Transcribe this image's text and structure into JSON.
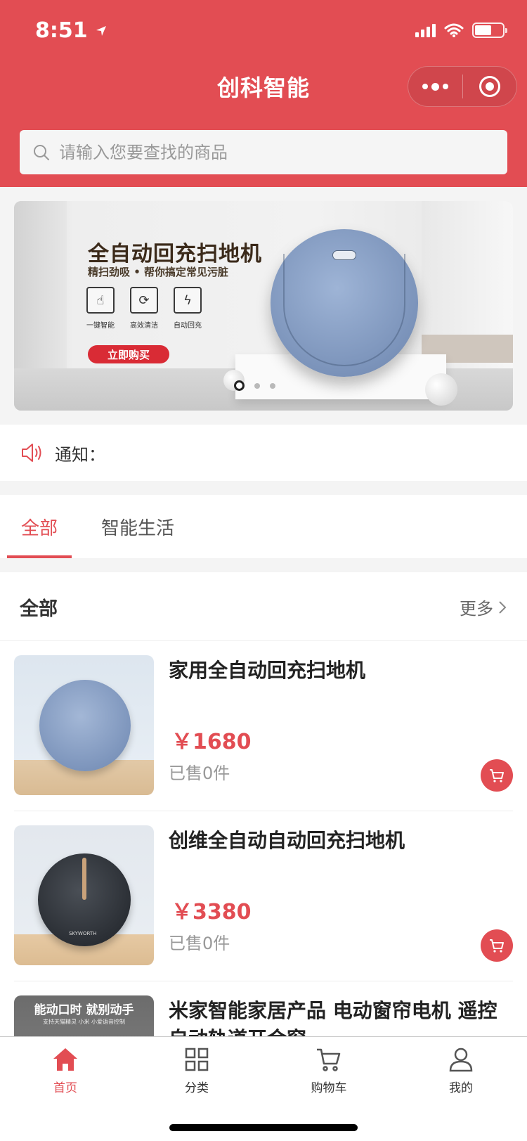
{
  "status_bar": {
    "time": "8:51"
  },
  "nav": {
    "title": "创科智能"
  },
  "search": {
    "placeholder": "请输入您要查找的商品"
  },
  "banner": {
    "title": "全自动回充扫地机",
    "subtitle": "精扫劲吸 • 帮你搞定常见污脏",
    "features": [
      {
        "label": "一键智能",
        "icon": "tap-icon"
      },
      {
        "label": "高效清洁",
        "icon": "swirl-icon"
      },
      {
        "label": "自动回充",
        "icon": "lightning-icon"
      }
    ],
    "buy_label": "立即购买",
    "slide_index": 1,
    "slide_count": 3
  },
  "notice": {
    "label": "通知："
  },
  "tabs": [
    {
      "label": "全部",
      "active": true
    },
    {
      "label": "智能生活",
      "active": false
    }
  ],
  "section": {
    "title": "全部",
    "more_label": "更多",
    "products": [
      {
        "name": "家用全自动回充扫地机",
        "price": "￥1680",
        "sold": "已售0件"
      },
      {
        "name": "创维全自动自动回充扫地机",
        "price": "￥3380",
        "sold": "已售0件",
        "thumb_brand": "SKYWORTH"
      },
      {
        "name": "米家智能家居产品 电动窗帘电机 遥控自动轨道开合窗",
        "thumb_ad": "能动口时 就别动手",
        "thumb_ad_sub": "支持天猫精灵 小米 小爱语音控制"
      }
    ]
  },
  "tabbar": [
    {
      "label": "首页",
      "icon": "home-icon",
      "active": true
    },
    {
      "label": "分类",
      "icon": "grid-icon",
      "active": false
    },
    {
      "label": "购物车",
      "icon": "cart-icon",
      "active": false
    },
    {
      "label": "我的",
      "icon": "user-icon",
      "active": false
    }
  ],
  "colors": {
    "brand": "#e24d53",
    "text": "#333333",
    "muted": "#999999"
  }
}
